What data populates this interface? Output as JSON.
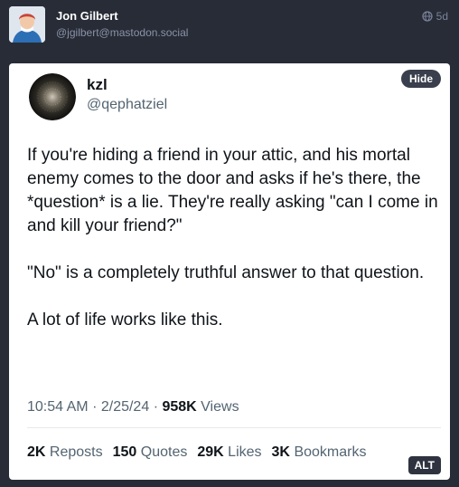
{
  "post": {
    "author_name": "Jon Gilbert",
    "author_handle": "@jgilbert@mastodon.social",
    "visibility_icon": "globe-icon",
    "time": "5d"
  },
  "media": {
    "hide_label": "Hide",
    "alt_label": "ALT"
  },
  "tweet": {
    "name": "kzl",
    "handle": "@qephatziel",
    "paragraphs": [
      "If you're hiding a friend in your attic, and his mortal enemy comes to the door and asks if he's there, the *question* is a lie. They're really asking \"can I come in and kill your friend?\"",
      "\"No\" is a completely truthful answer to that question.",
      "A lot of life works like this."
    ],
    "time": "10:54 AM",
    "separator": "·",
    "date": "2/25/24",
    "views_count": "958K",
    "views_label": "Views",
    "reposts_count": "2K",
    "reposts_label": "Reposts",
    "quotes_count": "150",
    "quotes_label": "Quotes",
    "likes_count": "29K",
    "likes_label": "Likes",
    "bookmarks_count": "3K",
    "bookmarks_label": "Bookmarks"
  },
  "colors": {
    "page_background": "#282c37",
    "muted_text": "#8b92a8",
    "tweet_text": "#0f1419",
    "tweet_secondary": "#536471"
  }
}
